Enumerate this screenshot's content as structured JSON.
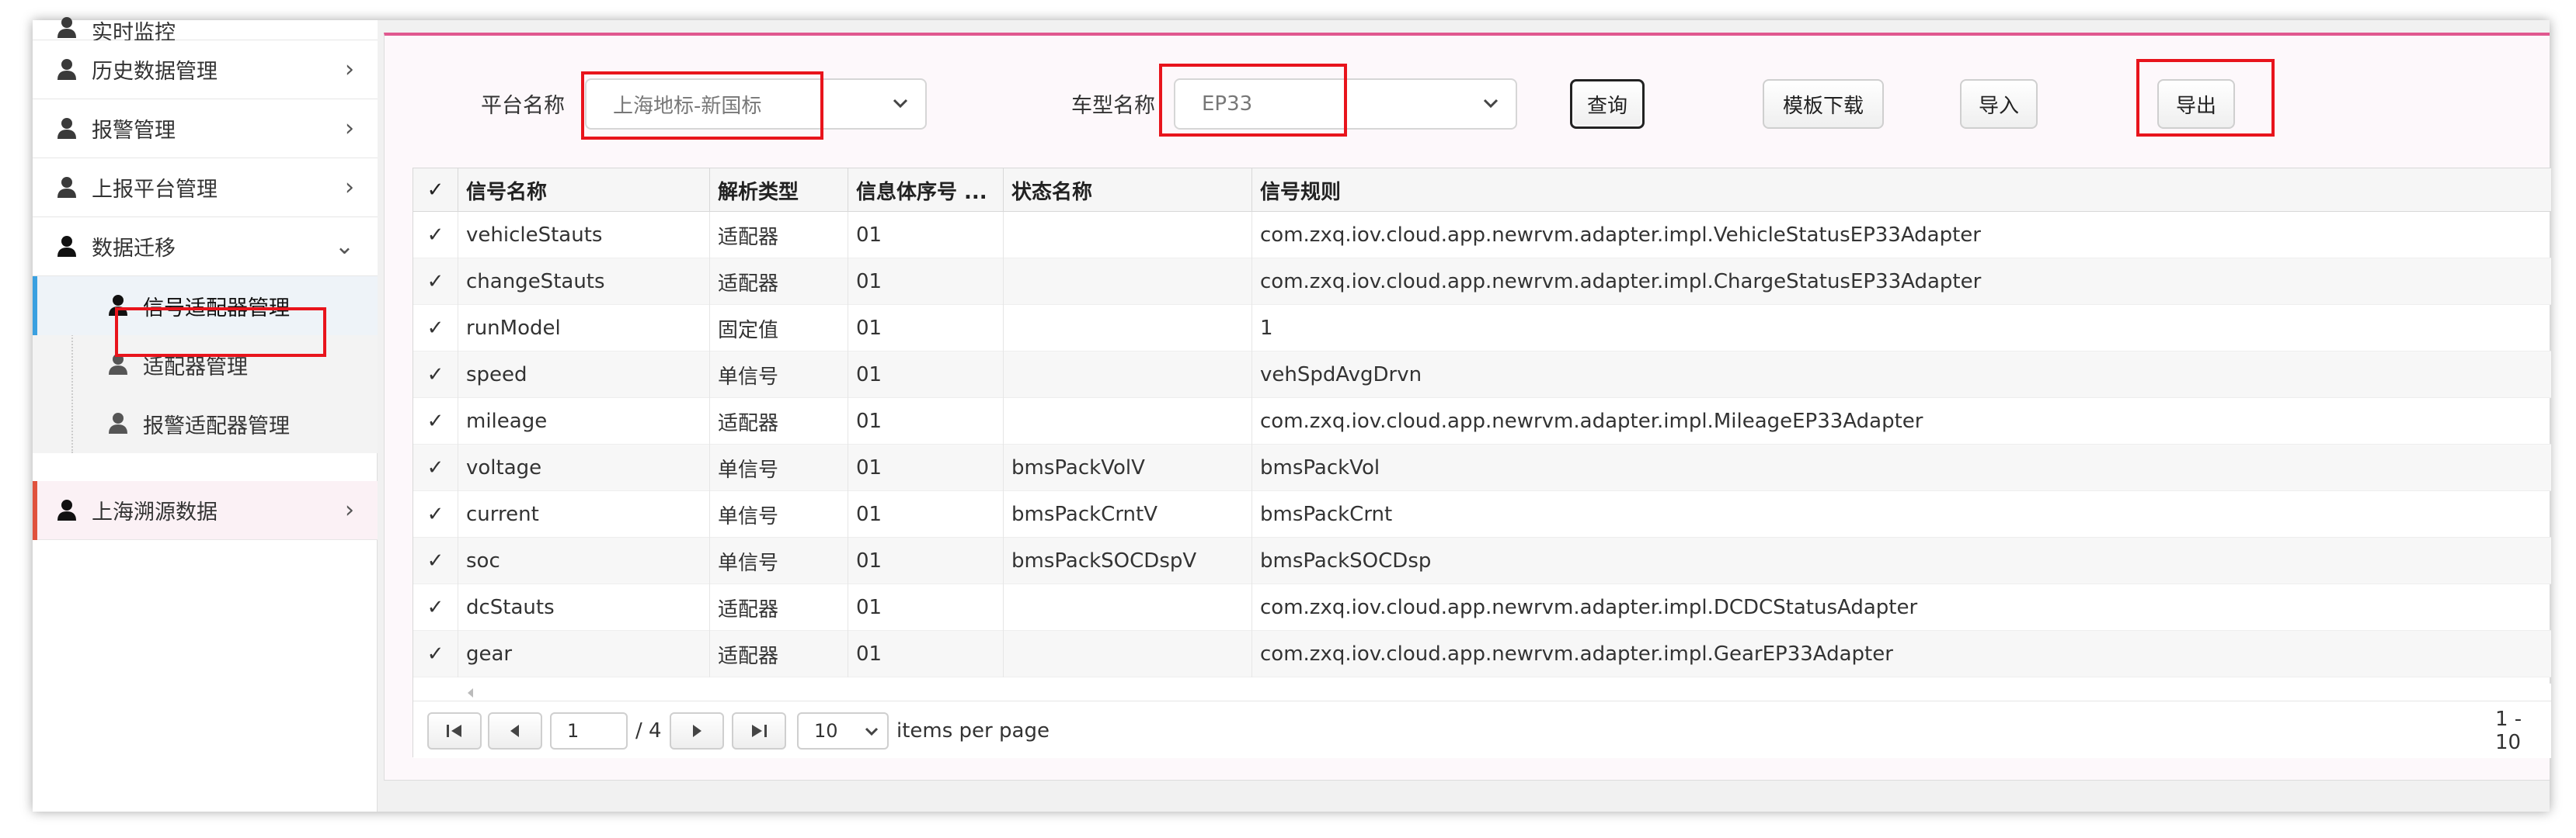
{
  "colors": {
    "accent_pink": "#e0588f",
    "highlight_red": "#e8141c",
    "selected_bar_blue": "#3aa0e0",
    "bottom_bar_red": "#e0523d"
  },
  "sidebar": {
    "top_partial": "实时监控",
    "items": [
      {
        "label": "历史数据管理",
        "icon": "user-icon",
        "chevron": "›"
      },
      {
        "label": "报警管理",
        "icon": "user-icon",
        "chevron": "›"
      },
      {
        "label": "上报平台管理",
        "icon": "user-icon",
        "chevron": "›"
      },
      {
        "label": "数据迁移",
        "icon": "user-icon",
        "chevron": "⌄"
      }
    ],
    "sub_items": [
      {
        "label": "信号适配器管理",
        "icon": "user-icon"
      },
      {
        "label": "适配器管理",
        "icon": "user-icon"
      },
      {
        "label": "报警适配器管理",
        "icon": "user-icon"
      }
    ],
    "bottom_item": {
      "label": "上海溯源数据",
      "icon": "user-icon",
      "chevron": "›"
    }
  },
  "filters": {
    "platform_label": "平台名称",
    "platform_value": "上海地标-新国标",
    "model_label": "车型名称",
    "model_value": "EP33"
  },
  "toolbar": {
    "query": "查询",
    "template_download": "模板下载",
    "import": "导入",
    "export": "导出"
  },
  "grid": {
    "check_glyph": "✓",
    "columns": [
      "信号名称",
      "解析类型",
      "信息体序号 ...",
      "状态名称",
      "信号规则"
    ],
    "rows": [
      [
        "vehicleStauts",
        "适配器",
        "01",
        "",
        "com.zxq.iov.cloud.app.newrvm.adapter.impl.VehicleStatusEP33Adapter"
      ],
      [
        "changeStauts",
        "适配器",
        "01",
        "",
        "com.zxq.iov.cloud.app.newrvm.adapter.impl.ChargeStatusEP33Adapter"
      ],
      [
        "runModel",
        "固定值",
        "01",
        "",
        "1"
      ],
      [
        "speed",
        "单信号",
        "01",
        "",
        "vehSpdAvgDrvn"
      ],
      [
        "mileage",
        "适配器",
        "01",
        "",
        "com.zxq.iov.cloud.app.newrvm.adapter.impl.MileageEP33Adapter"
      ],
      [
        "voltage",
        "单信号",
        "01",
        "bmsPackVolV",
        "bmsPackVol"
      ],
      [
        "current",
        "单信号",
        "01",
        "bmsPackCrntV",
        "bmsPackCrnt"
      ],
      [
        "soc",
        "单信号",
        "01",
        "bmsPackSOCDspV",
        "bmsPackSOCDsp"
      ],
      [
        "dcStauts",
        "适配器",
        "01",
        "",
        "com.zxq.iov.cloud.app.newrvm.adapter.impl.DCDCStatusAdapter"
      ],
      [
        "gear",
        "适配器",
        "01",
        "",
        "com.zxq.iov.cloud.app.newrvm.adapter.impl.GearEP33Adapter"
      ]
    ]
  },
  "pager": {
    "first": "⏮",
    "prev": "◀",
    "next": "▶",
    "last": "⏭",
    "page": "1",
    "of_total": "/ 4",
    "page_size": "10",
    "per_page_label": "items per page",
    "range": "1 - 10"
  }
}
